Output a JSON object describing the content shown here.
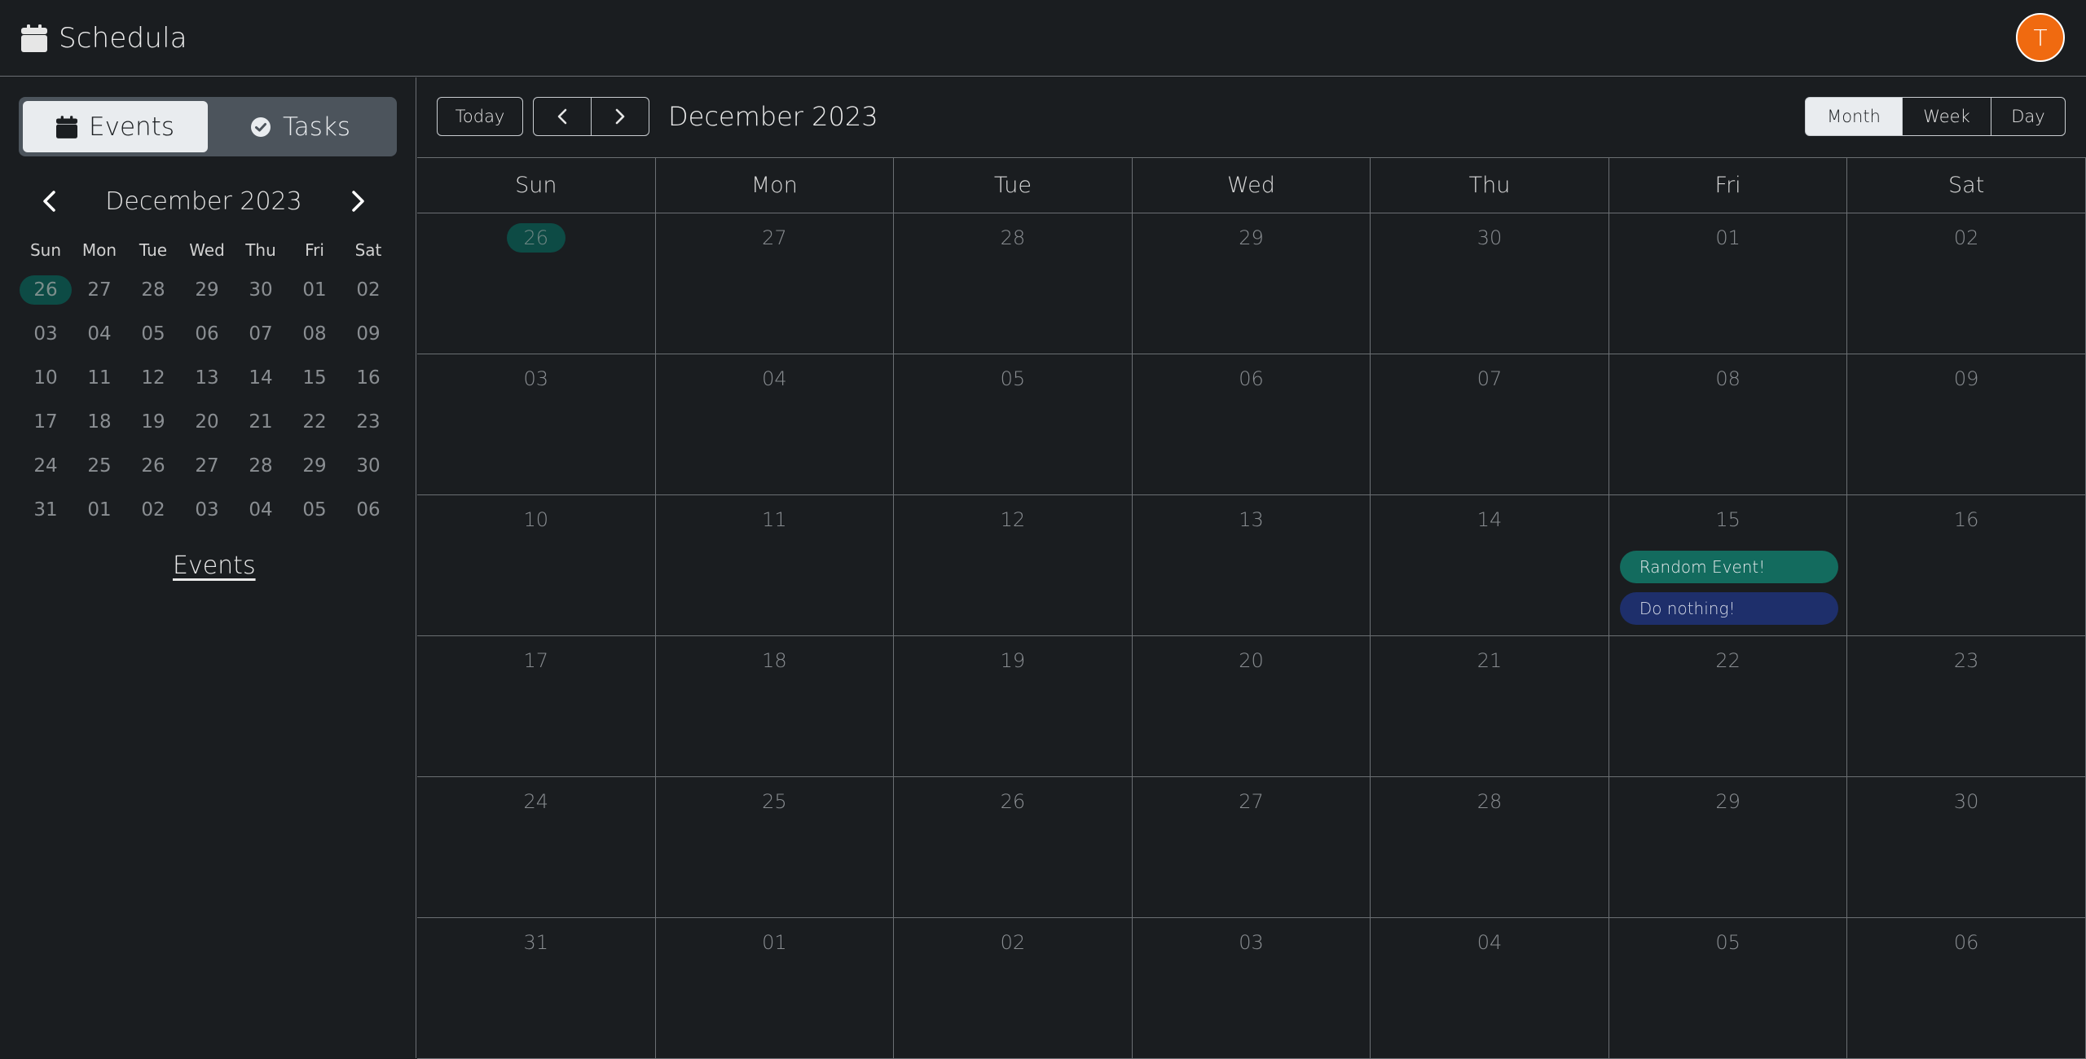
{
  "app": {
    "title": "Schedula",
    "avatar_initial": "T"
  },
  "sidebar": {
    "toggle": {
      "events_label": "Events",
      "tasks_label": "Tasks"
    },
    "mini_calendar": {
      "title": "December 2023",
      "weekdays": [
        "Sun",
        "Mon",
        "Tue",
        "Wed",
        "Thu",
        "Fri",
        "Sat"
      ],
      "weeks": [
        [
          "26",
          "27",
          "28",
          "29",
          "30",
          "01",
          "02"
        ],
        [
          "03",
          "04",
          "05",
          "06",
          "07",
          "08",
          "09"
        ],
        [
          "10",
          "11",
          "12",
          "13",
          "14",
          "15",
          "16"
        ],
        [
          "17",
          "18",
          "19",
          "20",
          "21",
          "22",
          "23"
        ],
        [
          "24",
          "25",
          "26",
          "27",
          "28",
          "29",
          "30"
        ],
        [
          "31",
          "01",
          "02",
          "03",
          "04",
          "05",
          "06"
        ]
      ],
      "highlighted_cell": [
        0,
        0
      ]
    },
    "events_link": "Events"
  },
  "toolbar": {
    "today_label": "Today",
    "title": "December 2023",
    "views": [
      "Month",
      "Week",
      "Day"
    ],
    "active_view": "Month"
  },
  "calendar": {
    "weekdays": [
      "Sun",
      "Mon",
      "Tue",
      "Wed",
      "Thu",
      "Fri",
      "Sat"
    ],
    "weeks": [
      [
        "26",
        "27",
        "28",
        "29",
        "30",
        "01",
        "02"
      ],
      [
        "03",
        "04",
        "05",
        "06",
        "07",
        "08",
        "09"
      ],
      [
        "10",
        "11",
        "12",
        "13",
        "14",
        "15",
        "16"
      ],
      [
        "17",
        "18",
        "19",
        "20",
        "21",
        "22",
        "23"
      ],
      [
        "24",
        "25",
        "26",
        "27",
        "28",
        "29",
        "30"
      ],
      [
        "31",
        "01",
        "02",
        "03",
        "04",
        "05",
        "06"
      ]
    ],
    "highlighted_cell": [
      0,
      0
    ],
    "events": [
      {
        "week": 2,
        "day": 5,
        "title": "Random Event!",
        "color": "#136b5e"
      },
      {
        "week": 2,
        "day": 5,
        "title": "Do nothing!",
        "color": "#1e2f6b"
      }
    ]
  },
  "colors": {
    "background": "#1a1d20",
    "accent_today": "#0d4b45",
    "avatar": "#f06a10"
  }
}
